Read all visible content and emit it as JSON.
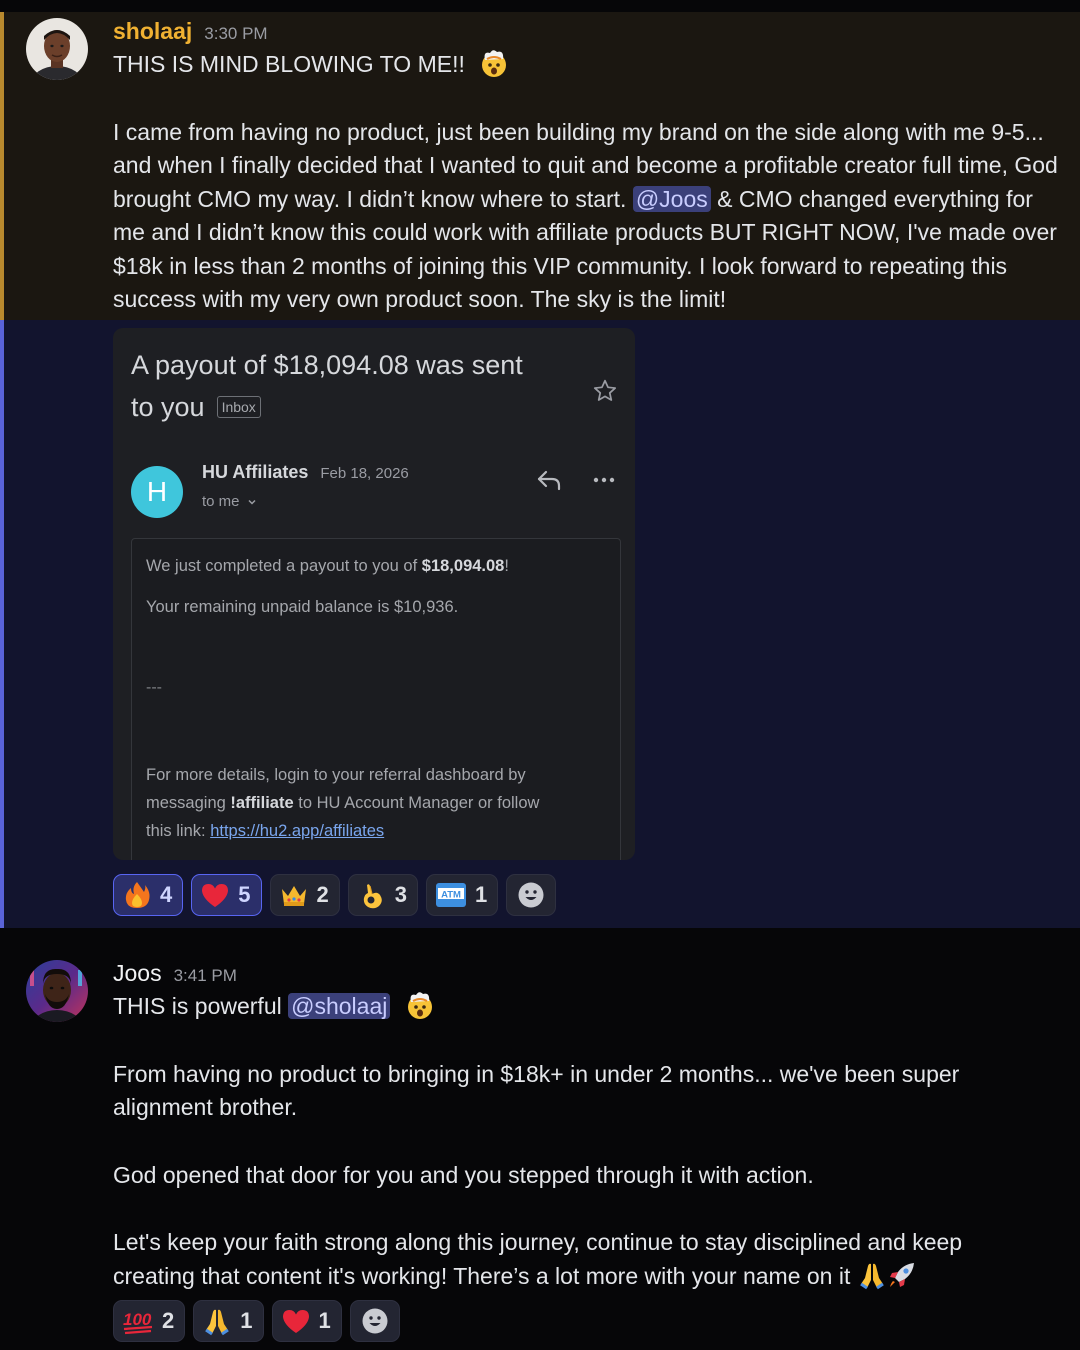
{
  "messages": [
    {
      "author": "sholaaj",
      "author_color": "#f0b132",
      "time": "3:30 PM",
      "line1": "THIS IS MIND BLOWING TO ME!!",
      "para_before_mention": "I came from having no product, just been building my brand on the side along with me 9-5... and when I finally decided that I wanted to quit and become a profitable creator full time, God brought CMO my way. I didn’t know where to start.",
      "mention": "@Joos",
      "para_after_mention": " & CMO changed everything for me and I didn’t know this could work with affiliate products BUT RIGHT NOW, I've made over $18k in less than 2 months of joining this VIP community. I look forward to repeating this success with my very own product soon. The sky is the limit!",
      "email": {
        "subject_line1": "A payout of $18,094.08 was sent",
        "subject_line2": "to you",
        "label": "Inbox",
        "sender": "HU Affiliates",
        "date": "Feb 18, 2026",
        "avatar_letter": "H",
        "to": "to me",
        "body1_prefix": "We just completed a payout to you of ",
        "body1_amount": "$18,094.08",
        "body1_suffix": "!",
        "body2": "Your remaining unpaid balance is $10,936.",
        "separator": "---",
        "footer1": "For more details, login to your referral dashboard by",
        "footer2_prefix": "messaging ",
        "footer2_bold": "!affiliate",
        "footer2_suffix": " to HU Account Manager or follow",
        "footer3_prefix": "this link: ",
        "footer3_link": "https://hu2.app/affiliates"
      },
      "reactions": [
        {
          "emoji": "fire",
          "count": "4",
          "active": true
        },
        {
          "emoji": "heart",
          "count": "5",
          "active": true
        },
        {
          "emoji": "crown",
          "count": "2",
          "active": false
        },
        {
          "emoji": "ok-hand",
          "count": "3",
          "active": false
        },
        {
          "emoji": "atm",
          "count": "1",
          "active": false
        }
      ]
    },
    {
      "author": "Joos",
      "author_color": "#f2f3f5",
      "time": "3:41 PM",
      "line1_prefix": "THIS is powerful ",
      "mention": "@sholaaj",
      "para1": "From having no product to bringing in $18k+ in under 2 months... we've been super alignment brother.",
      "para2": "God opened that door for you and you stepped through it with action.",
      "para3": "Let's keep your faith strong along this journey, continue to stay disciplined and keep creating that content it's working! There’s a lot more with your name on it",
      "reactions": [
        {
          "emoji": "hundred",
          "count": "2"
        },
        {
          "emoji": "pray",
          "count": "1"
        },
        {
          "emoji": "heart",
          "count": "1"
        }
      ]
    }
  ]
}
